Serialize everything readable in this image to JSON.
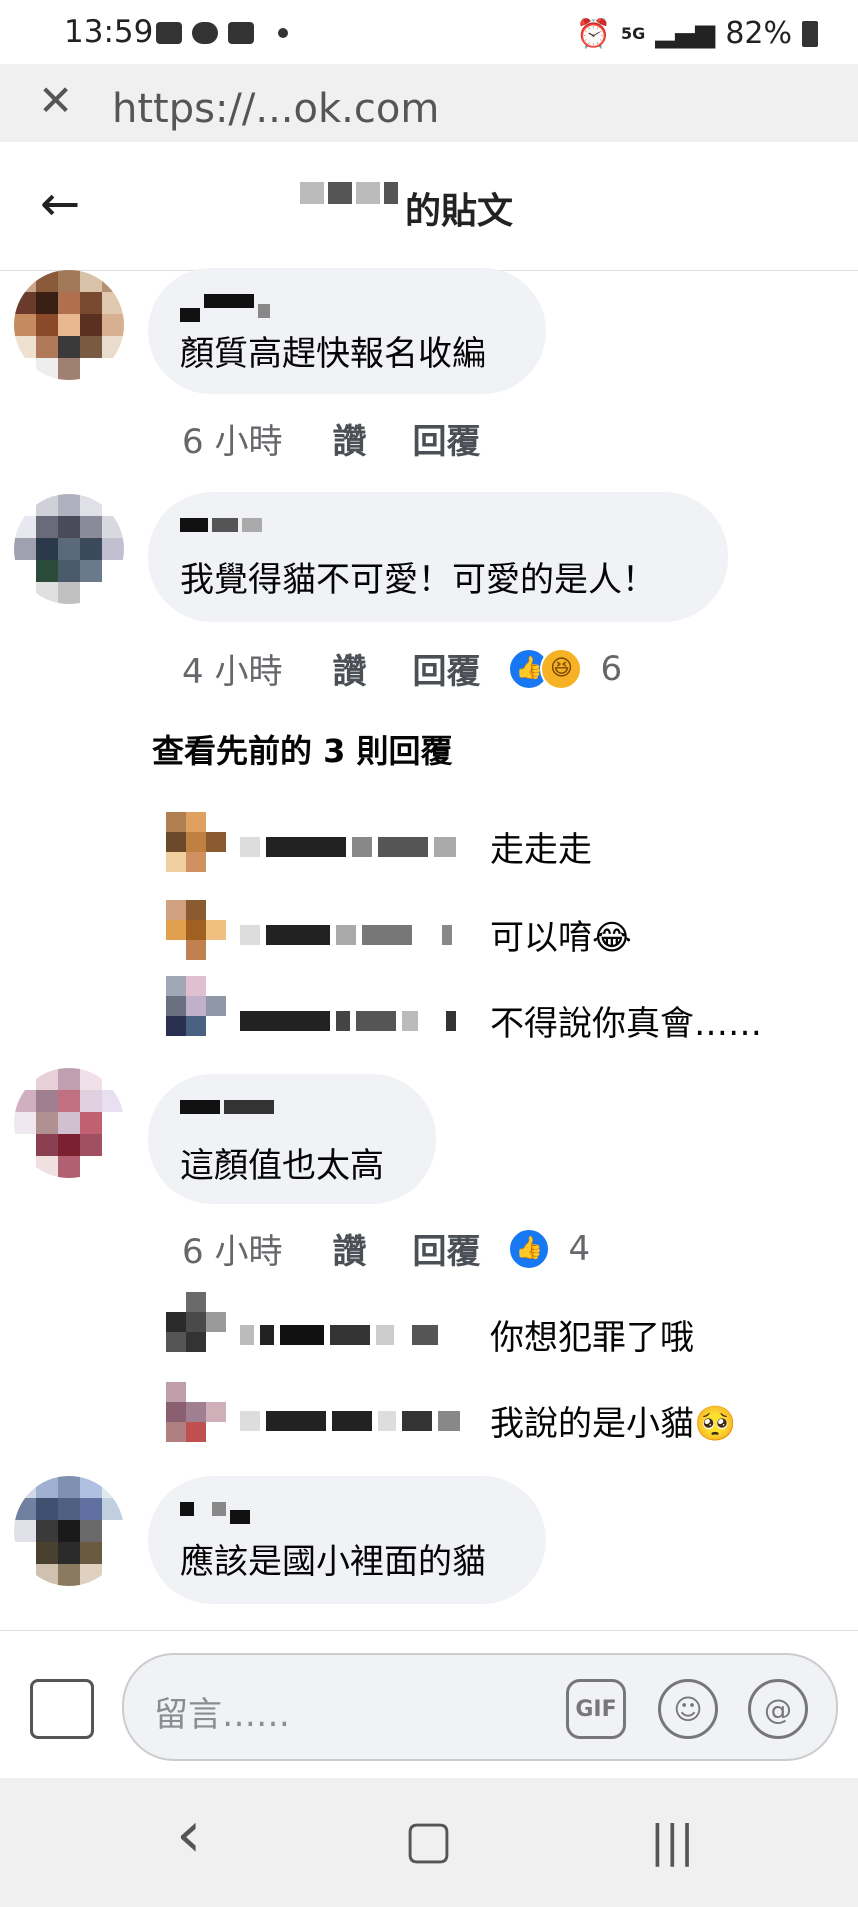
{
  "status": {
    "time": "13:59",
    "network": "5G",
    "battery": "82%"
  },
  "browser": {
    "close_glyph": "✕",
    "url": "https://...ok.com"
  },
  "header": {
    "back_glyph": "←",
    "title": "的貼文"
  },
  "comments": [
    {
      "text": "顏質高趕快報名收編",
      "time": "6 小時",
      "like": "讚",
      "reply": "回覆",
      "reaction_count": ""
    },
    {
      "text": "我覺得貓不可愛！可愛的是人！",
      "time": "4 小時",
      "like": "讚",
      "reply": "回覆",
      "reaction_count": "6"
    },
    {
      "text": "這顏值也太高",
      "time": "6 小時",
      "like": "讚",
      "reply": "回覆",
      "reaction_count": "4"
    },
    {
      "text": "應該是國小裡面的貓"
    }
  ],
  "view_previous": "查看先前的 3 則回覆",
  "replies_a": [
    {
      "text": "走走走"
    },
    {
      "text": "可以唷😂"
    },
    {
      "text": "不得說你真會……"
    }
  ],
  "replies_b": [
    {
      "text": "你想犯罪了哦"
    },
    {
      "text": "我說的是小貓🥺"
    }
  ],
  "composer": {
    "placeholder": "留言……",
    "gif": "GIF",
    "emoji_glyph": "☺",
    "mention_glyph": "@"
  },
  "nav": {
    "back_glyph": "‹",
    "home_glyph": "▢",
    "recents_glyph": "|||"
  },
  "icons": {
    "like": "thumbs-up-icon",
    "haha": "haha-icon"
  }
}
